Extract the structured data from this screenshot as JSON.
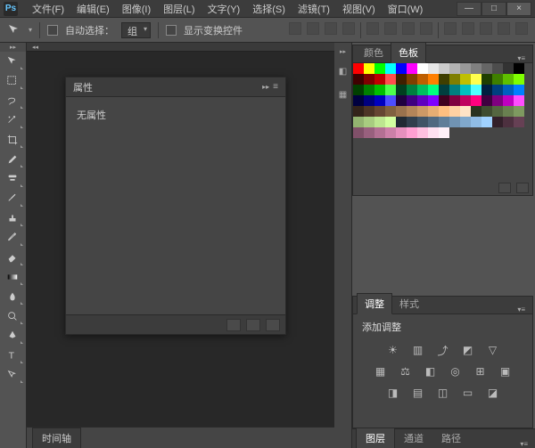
{
  "app": {
    "logo_text": "Ps"
  },
  "menu": [
    {
      "label": "文件(F)"
    },
    {
      "label": "编辑(E)"
    },
    {
      "label": "图像(I)"
    },
    {
      "label": "图层(L)"
    },
    {
      "label": "文字(Y)"
    },
    {
      "label": "选择(S)"
    },
    {
      "label": "滤镜(T)"
    },
    {
      "label": "视图(V)"
    },
    {
      "label": "窗口(W)"
    }
  ],
  "window_controls": {
    "minimize": "—",
    "maximize": "□",
    "close": "×"
  },
  "options_bar": {
    "auto_select_label": "自动选择：",
    "group_value": "组",
    "show_transform_label": "显示变换控件"
  },
  "toolbox": {
    "tools": [
      {
        "name": "move-tool"
      },
      {
        "name": "marquee-tool"
      },
      {
        "name": "lasso-tool"
      },
      {
        "name": "magic-wand-tool"
      },
      {
        "name": "crop-tool"
      },
      {
        "name": "eyedropper-tool"
      },
      {
        "name": "healing-brush-tool"
      },
      {
        "name": "brush-tool"
      },
      {
        "name": "clone-stamp-tool"
      },
      {
        "name": "history-brush-tool"
      },
      {
        "name": "eraser-tool"
      },
      {
        "name": "gradient-tool"
      },
      {
        "name": "blur-tool"
      },
      {
        "name": "dodge-tool"
      },
      {
        "name": "pen-tool"
      },
      {
        "name": "type-tool"
      },
      {
        "name": "path-selection-tool"
      }
    ]
  },
  "properties_panel": {
    "tab_label": "属性",
    "body_text": "无属性"
  },
  "timeline": {
    "tab_label": "时间轴"
  },
  "color_panel": {
    "tab_color": "颜色",
    "tab_swatches": "色板"
  },
  "swatches": [
    "#ff0000",
    "#ffff00",
    "#00ff00",
    "#00ffff",
    "#0000ff",
    "#ff00ff",
    "#ffffff",
    "#e6e6e6",
    "#cccccc",
    "#b3b3b3",
    "#999999",
    "#808080",
    "#666666",
    "#4d4d4d",
    "#333333",
    "#000000",
    "#3f0000",
    "#7f0000",
    "#bf0000",
    "#ff4d4d",
    "#3f1f00",
    "#7f3f00",
    "#bf5f00",
    "#ff7f00",
    "#3f3f00",
    "#7f7f00",
    "#bfbf00",
    "#ffff4d",
    "#1f3f00",
    "#3f7f00",
    "#5fbf00",
    "#7fff00",
    "#003f00",
    "#007f00",
    "#00bf00",
    "#4dff4d",
    "#003f1f",
    "#007f3f",
    "#00bf5f",
    "#00ff7f",
    "#003f3f",
    "#007f7f",
    "#00bfbf",
    "#4dffff",
    "#001f3f",
    "#003f7f",
    "#005fbf",
    "#007fff",
    "#00003f",
    "#00007f",
    "#0000bf",
    "#4d4dff",
    "#1f003f",
    "#3f007f",
    "#5f00bf",
    "#7f00ff",
    "#3f001f",
    "#7f003f",
    "#bf005f",
    "#ff007f",
    "#3f003f",
    "#7f007f",
    "#bf00bf",
    "#ff4dff",
    "#33231a",
    "#4d3526",
    "#664633",
    "#806040",
    "#99724d",
    "#b38559",
    "#cc9966",
    "#e6ad73",
    "#ffbf80",
    "#ffd1a3",
    "#ffe3c6",
    "#2a3320",
    "#3f4d30",
    "#546640",
    "#698050",
    "#7e9960",
    "#93b370",
    "#a8cc80",
    "#bde690",
    "#d2ffa0",
    "#202a33",
    "#303f4d",
    "#405466",
    "#506980",
    "#607e99",
    "#7093b3",
    "#80a8cc",
    "#90bde6",
    "#a0d2ff",
    "#33202a",
    "#4d303f",
    "#664054",
    "#805069",
    "#99607e",
    "#b37093",
    "#cc80a8",
    "#e690bd",
    "#ffa0d2",
    "#ffc0e0",
    "#ffe0f0",
    "#fff0f8"
  ],
  "adjustments_panel": {
    "tab_adjust": "调整",
    "tab_styles": "样式",
    "title": "添加调整",
    "icons_row1": [
      "brightness-icon",
      "levels-icon",
      "curves-icon",
      "exposure-icon",
      "vibrance-icon"
    ],
    "icons_row2": [
      "hue-icon",
      "balance-icon",
      "bw-icon",
      "photo-filter-icon",
      "channel-mixer-icon",
      "lookup-icon"
    ],
    "icons_row3": [
      "invert-icon",
      "posterize-icon",
      "threshold-icon",
      "gradient-map-icon",
      "selective-icon"
    ]
  },
  "layers_panel": {
    "tab_layers": "图层",
    "tab_channels": "通道",
    "tab_paths": "路径"
  }
}
